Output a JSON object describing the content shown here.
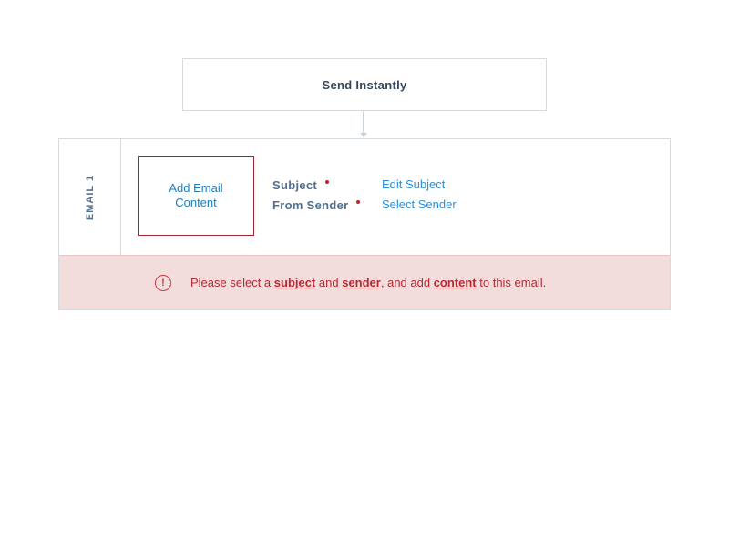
{
  "trigger": {
    "label": "Send Instantly"
  },
  "email": {
    "label": "EMAIL 1",
    "add_content_label": "Add Email Content",
    "fields": [
      {
        "label": "Subject",
        "link": "Edit Subject"
      },
      {
        "label": "From Sender",
        "link": "Select Sender"
      }
    ]
  },
  "error": {
    "icon": "alert-circle-icon",
    "prefix": "Please select a ",
    "subject_link": "subject",
    "and_1": " and ",
    "sender_link": "sender",
    "middle": ", and add ",
    "content_link": "content",
    "suffix": " to this email."
  },
  "colors": {
    "error_bg": "#f3dcdc",
    "error_text": "#b62932",
    "link_blue": "#2d8fd5",
    "label_slate": "#516f90"
  }
}
